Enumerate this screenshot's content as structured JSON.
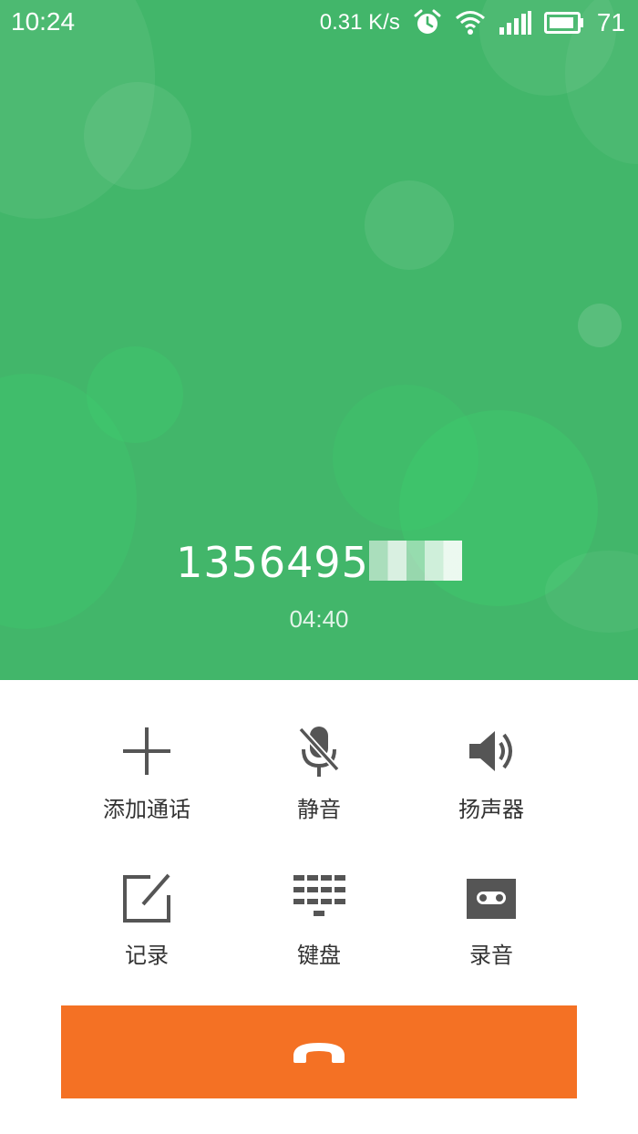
{
  "status_bar": {
    "time": "10:24",
    "net_speed": "0.31 K/s",
    "battery": "71",
    "icons": [
      "alarm-icon",
      "wifi-icon",
      "signal-icon",
      "battery-icon"
    ]
  },
  "call": {
    "number_visible": "1356495",
    "duration": "04:40"
  },
  "actions": [
    {
      "label": "添加通话",
      "icon": "add-call-icon"
    },
    {
      "label": "静音",
      "icon": "mute-icon"
    },
    {
      "label": "扬声器",
      "icon": "speaker-icon"
    },
    {
      "label": "记录",
      "icon": "note-icon"
    },
    {
      "label": "键盘",
      "icon": "keypad-icon"
    },
    {
      "label": "录音",
      "icon": "record-icon"
    }
  ],
  "end_call": {
    "icon": "hang-up-icon"
  },
  "colors": {
    "header_green": "#42b66a",
    "end_call_orange": "#f47124",
    "icon_gray": "#555555"
  }
}
